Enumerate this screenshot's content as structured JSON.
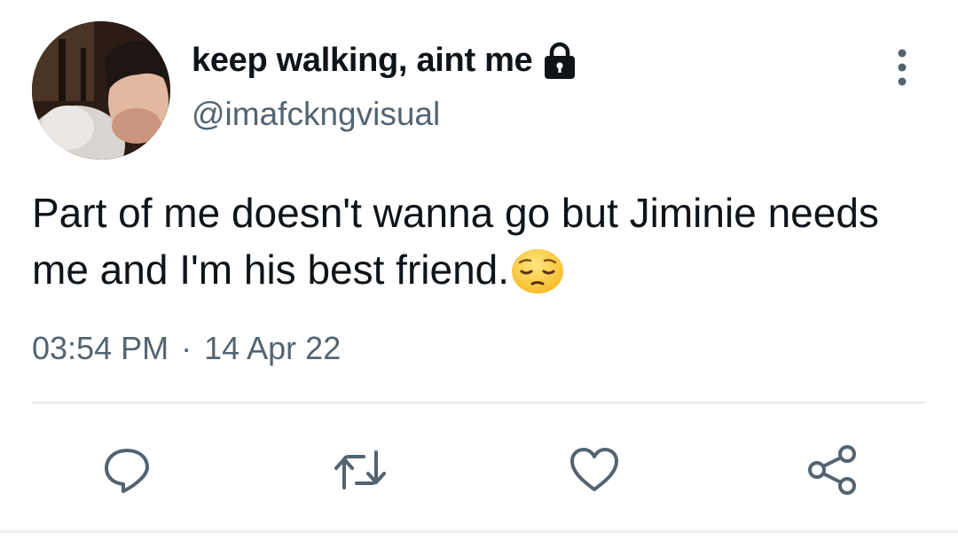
{
  "tweet": {
    "display_name": "keep walking, aint me",
    "handle": "@imafckngvisual",
    "text": "Part of me doesn't wanna go but Jiminie needs me and I'm his best friend.",
    "emoji": "pensive-face",
    "time": "03:54 PM",
    "separator": "·",
    "date": "14 Apr 22",
    "protected": true
  },
  "icons": {
    "lock": "lock-icon",
    "more": "more-vertical-icon",
    "reply": "reply-icon",
    "retweet": "retweet-icon",
    "like": "heart-icon",
    "share": "share-icon"
  },
  "colors": {
    "text_primary": "#0f1419",
    "text_secondary": "#536471",
    "icon": "#536471",
    "divider": "#e7eaed"
  }
}
